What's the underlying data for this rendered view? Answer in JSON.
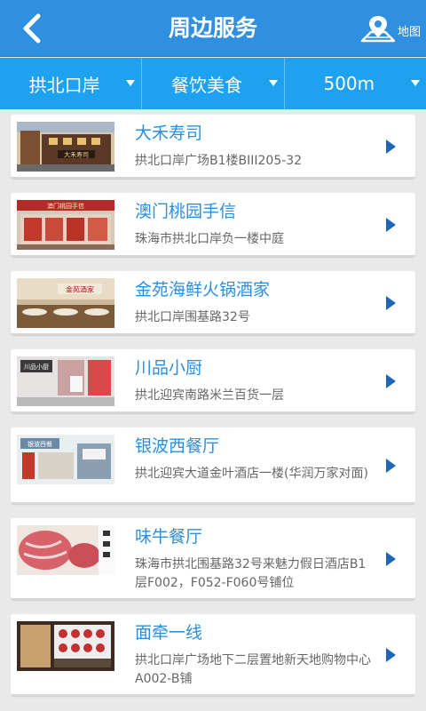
{
  "header": {
    "title": "周边服务",
    "back_icon": "chevron-left-icon",
    "map_label": "地图",
    "map_icon": "map-pin-icon",
    "bg_color": "#2f8fe0"
  },
  "filters": [
    {
      "label": "拱北口岸"
    },
    {
      "label": "餐饮美食"
    },
    {
      "label": "500m"
    }
  ],
  "filter_bar_color": "#1ea2ef",
  "restaurants": [
    {
      "name": "大禾寿司",
      "address": "拱北口岸广场B1楼BIII205-32"
    },
    {
      "name": "澳门桃园手信",
      "address": "珠海市拱北口岸负一楼中庭"
    },
    {
      "name": "金苑海鲜火锅酒家",
      "address": "拱北口岸围基路32号"
    },
    {
      "name": "川品小厨",
      "address": "拱北迎宾南路米兰百货一层"
    },
    {
      "name": "银波西餐厅",
      "address": "拱北迎宾大道金叶酒店一楼(华润万家对面)"
    },
    {
      "name": "味牛餐厅",
      "address": "珠海市拱北围基路32号来魅力假日酒店B1层F002，F052-F060号铺位"
    },
    {
      "name": "面牵一线",
      "address": "拱北口岸广场地下二层置地新天地购物中心A002-B铺"
    }
  ],
  "thumb_signs": [
    "大禾寿司",
    "澳门桃园手信",
    "金苑酒家",
    "川品小厨",
    "银波西餐",
    "",
    ""
  ]
}
